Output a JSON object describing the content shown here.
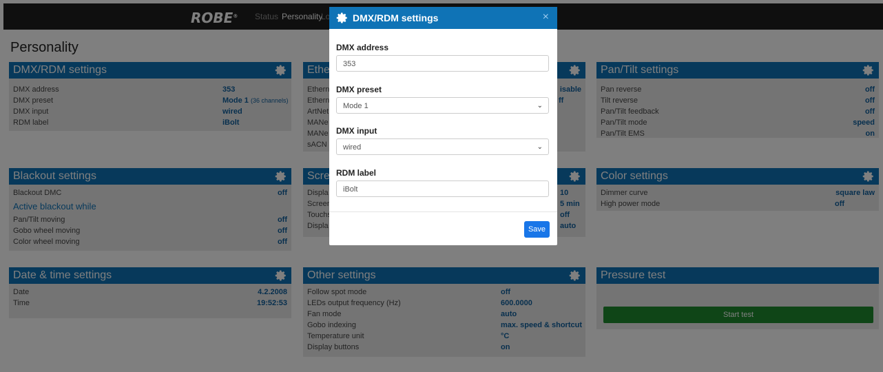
{
  "header": {
    "logo": "ROBE",
    "logo_mark": "®",
    "nav": [
      "Status",
      "Personality",
      "Lo"
    ]
  },
  "page_title": "Personality",
  "dmx_panel": {
    "title": "DMX/RDM settings",
    "rows": [
      {
        "label": "DMX address",
        "value": "353"
      },
      {
        "label": "DMX preset",
        "value": "Mode 1",
        "extra": "(36 channels)"
      },
      {
        "label": "DMX input",
        "value": "wired"
      },
      {
        "label": "RDM label",
        "value": "iBolt"
      }
    ]
  },
  "ethernet_panel": {
    "title": "Ether",
    "rows": [
      {
        "label": "Ethern",
        "value": "isable"
      },
      {
        "label": "Ethern",
        "value": "ff"
      },
      {
        "label": "ArtNet",
        "value": ""
      },
      {
        "label": "MANe",
        "value": ""
      },
      {
        "label": "MANe",
        "value": ""
      },
      {
        "label": "sACN (",
        "value": ""
      }
    ]
  },
  "pantilt_panel": {
    "title": "Pan/Tilt settings",
    "rows": [
      {
        "label": "Pan reverse",
        "value": "off"
      },
      {
        "label": "Tilt reverse",
        "value": "off"
      },
      {
        "label": "Pan/Tilt feedback",
        "value": "off"
      },
      {
        "label": "Pan/Tilt mode",
        "value": "speed"
      },
      {
        "label": "Pan/Tilt EMS",
        "value": "on"
      }
    ]
  },
  "blackout_panel": {
    "title": "Blackout settings",
    "dmc": {
      "label": "Blackout DMC",
      "value": "off"
    },
    "subheading": "Active blackout while",
    "rows": [
      {
        "label": "Pan/Tilt moving",
        "value": "off"
      },
      {
        "label": "Gobo wheel moving",
        "value": "off"
      },
      {
        "label": "Color wheel moving",
        "value": "off"
      }
    ]
  },
  "screen_panel": {
    "title": "Scre",
    "rows": [
      {
        "label": "Displa",
        "value": "10"
      },
      {
        "label": "Screen",
        "value": "5 min"
      },
      {
        "label": "Touchs",
        "value": "off"
      },
      {
        "label": "Displa",
        "value": "auto"
      }
    ]
  },
  "color_panel": {
    "title": "Color settings",
    "rows": [
      {
        "label": "Dimmer curve",
        "value": "square law"
      },
      {
        "label": "High power mode",
        "value": "off"
      }
    ]
  },
  "datetime_panel": {
    "title": "Date & time settings",
    "rows": [
      {
        "label": "Date",
        "value": "4.2.2008"
      },
      {
        "label": "Time",
        "value": "19:52:53"
      }
    ]
  },
  "other_panel": {
    "title": "Other settings",
    "rows": [
      {
        "label": "Follow spot mode",
        "value": "off"
      },
      {
        "label": "LEDs output frequency (Hz)",
        "value": "600.0000"
      },
      {
        "label": "Fan mode",
        "value": "auto"
      },
      {
        "label": "Gobo indexing",
        "value": "max. speed & shortcut"
      },
      {
        "label": "Temperature unit",
        "value": "°C"
      },
      {
        "label": "Display buttons",
        "value": "on"
      }
    ]
  },
  "pressure_panel": {
    "title": "Pressure test",
    "button": "Start test"
  },
  "modal": {
    "title": "DMX/RDM settings",
    "close": "×",
    "address_label": "DMX address",
    "address_value": "353",
    "preset_label": "DMX preset",
    "preset_value": "Mode 1",
    "input_label": "DMX input",
    "input_value": "wired",
    "rdm_label": "RDM label",
    "rdm_value": "iBolt",
    "save": "Save"
  },
  "colors": {
    "header": "#0f73b6",
    "value": "#0f5e9c",
    "button": "#1976e8",
    "start": "#1e8a2e"
  }
}
